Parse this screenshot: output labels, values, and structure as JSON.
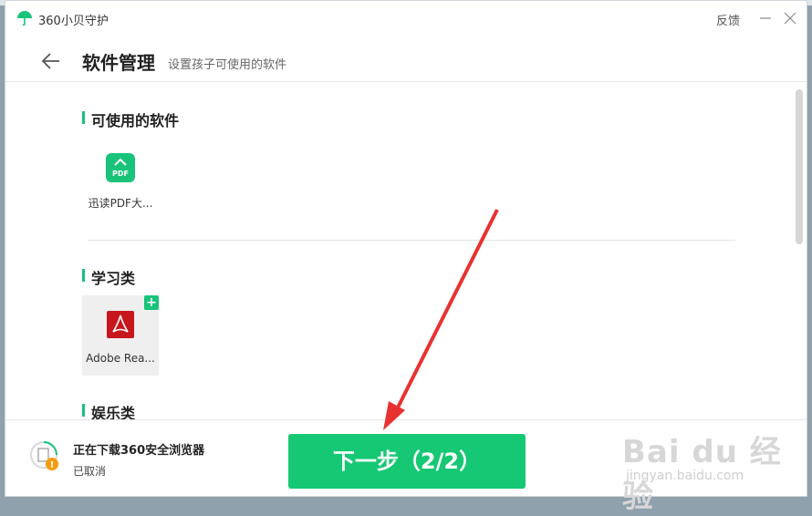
{
  "app": {
    "title": "360小贝守护",
    "feedback": "反馈"
  },
  "header": {
    "title": "软件管理",
    "subtitle": "设置孩子可使用的软件"
  },
  "sections": [
    {
      "title": "可使用的软件",
      "apps": [
        {
          "label": "迅读PDF大...",
          "icon": "pdf-reader-icon",
          "icon_text": "PDF"
        }
      ]
    },
    {
      "title": "学习类",
      "apps": [
        {
          "label": "Adobe Rea...",
          "icon": "adobe-reader-icon",
          "badge": "+"
        }
      ]
    },
    {
      "title": "娱乐类",
      "apps": []
    }
  ],
  "footer": {
    "download_title": "正在下载360安全浏览器",
    "download_status": "已取消",
    "next_label": "下一步（2/2）"
  },
  "watermark": {
    "main": "Bai du 经验",
    "sub": "jingyan.baidu.com"
  },
  "colors": {
    "accent": "#16c873",
    "arrow": "#e8322f"
  }
}
